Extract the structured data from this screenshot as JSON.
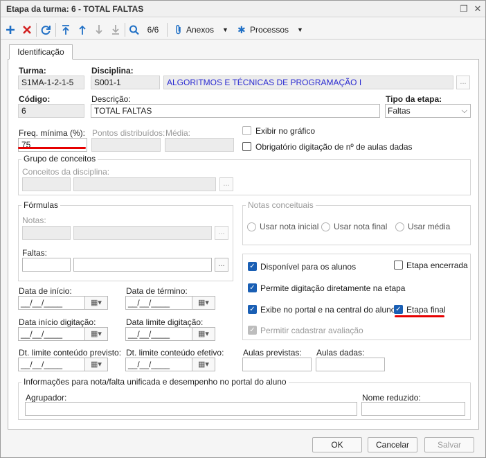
{
  "window": {
    "title": "Etapa da turma: 6 - TOTAL FALTAS",
    "restore_glyph": "❐",
    "close_glyph": "✕"
  },
  "toolbar": {
    "record_counter": "6/6",
    "anexos_label": "Anexos",
    "processos_label": "Processos",
    "icons": [
      "plus-icon",
      "delete-icon",
      "refresh-icon",
      "first-icon",
      "previous-icon",
      "next-icon",
      "last-icon",
      "search-icon",
      "paperclip-icon",
      "gear-icon"
    ]
  },
  "tabs": [
    {
      "label": "Identificação"
    }
  ],
  "form": {
    "turma": {
      "label": "Turma:",
      "value": "S1MA-1-2-1-5"
    },
    "disciplina": {
      "label": "Disciplina:",
      "code": "S001-1",
      "name": "ALGORITMOS E TÉCNICAS DE PROGRAMAÇÃO I"
    },
    "codigo": {
      "label": "Código:",
      "value": "6"
    },
    "descricao": {
      "label": "Descrição:",
      "value": "TOTAL FALTAS"
    },
    "tipo_etapa": {
      "label": "Tipo da etapa:",
      "value": "Faltas"
    },
    "freq_minima": {
      "label": "Freq. mínima (%):",
      "value": "75"
    },
    "pontos_distribuidos": {
      "label": "Pontos distribuídos:",
      "value": ""
    },
    "media": {
      "label": "Média:",
      "value": ""
    },
    "exibir_grafico": {
      "label": "Exibir no gráfico",
      "checked": false
    },
    "obrigatorio_aulas": {
      "label": "Obrigatório digitação de nº de aulas dadas",
      "checked": false
    },
    "grupo_conceitos": {
      "title": "Grupo de conceitos",
      "conceitos_label": "Conceitos da disciplina:"
    },
    "formulas": {
      "title": "Fórmulas",
      "notas_label": "Notas:",
      "faltas_label": "Faltas:"
    },
    "notas_conceituais": {
      "title": "Notas conceituais",
      "options": [
        {
          "label": "Usar nota inicial"
        },
        {
          "label": "Usar nota final"
        },
        {
          "label": "Usar média"
        }
      ]
    },
    "flags": {
      "disponivel_alunos": {
        "label": "Disponível para os alunos",
        "checked": true
      },
      "etapa_encerrada": {
        "label": "Etapa encerrada",
        "checked": false
      },
      "permite_digitacao": {
        "label": "Permite digitação diretamente na etapa",
        "checked": true
      },
      "exibe_portal": {
        "label": "Exibe no portal e na central do aluno",
        "checked": true
      },
      "etapa_final": {
        "label": "Etapa final",
        "checked": true
      },
      "permitir_avaliacao": {
        "label": "Permitir cadastrar avaliação",
        "checked": true
      }
    },
    "dates": {
      "placeholder": "__/__/____",
      "data_inicio": "Data de início:",
      "data_termino": "Data de término:",
      "data_inicio_digitacao": "Data início digitação:",
      "data_limite_digitacao": "Data limite digitação:",
      "dt_limite_previsto": "Dt. limite conteúdo previsto:",
      "dt_limite_efetivo": "Dt. limite conteúdo efetivo:"
    },
    "aulas_previstas": {
      "label": "Aulas previstas:",
      "value": ""
    },
    "aulas_dadas": {
      "label": "Aulas dadas:",
      "value": ""
    },
    "informacoes": {
      "title": "Informações para nota/falta unificada e desempenho no portal do aluno",
      "agrupador_label": "Agrupador:",
      "nome_reduzido_label": "Nome reduzido:"
    }
  },
  "footer": {
    "ok": "OK",
    "cancel": "Cancelar",
    "save": "Salvar"
  },
  "colors": {
    "accent": "#1a5fb4",
    "highlight": "#e60000",
    "link_text": "#2b2bd1"
  }
}
